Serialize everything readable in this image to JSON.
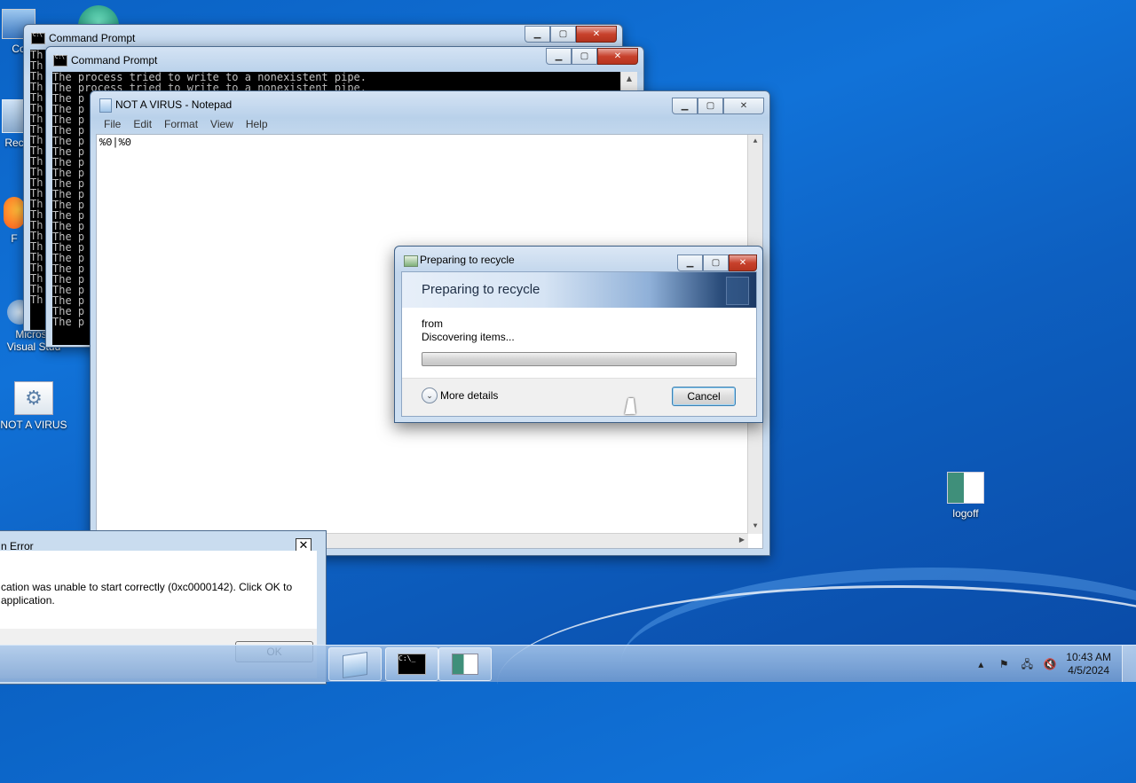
{
  "desktop": {
    "icons": [
      {
        "label": "Co"
      },
      {
        "label": "Rec"
      },
      {
        "label": "F"
      },
      {
        "label": "Microsc Visual Stud"
      },
      {
        "label": "NOT A VIRUS"
      },
      {
        "label": "logoff"
      }
    ]
  },
  "cmd_back": {
    "title": "Command Prompt",
    "lines": [
      "Th",
      "Th",
      "Th",
      "Th",
      "Th",
      "Th",
      "Th",
      "Th",
      "Th",
      "Th",
      "Th",
      "Th",
      "Th",
      "Th",
      "Th",
      "Th",
      "Th",
      "Th",
      "Th",
      "Th",
      "Th",
      "Th",
      "Th",
      "Th"
    ]
  },
  "cmd_front": {
    "title": "Command Prompt",
    "lines": [
      "The process tried to write to a nonexistent pipe.",
      "The process tried to write to a nonexistent pipe.",
      "The p",
      "The p",
      "The p",
      "The p",
      "The p",
      "The p",
      "The p",
      "The p",
      "The p",
      "The p",
      "The p",
      "The p",
      "The p",
      "The p",
      "The p",
      "The p",
      "The p",
      "The p",
      "The p",
      "The p",
      "The p",
      "The p"
    ]
  },
  "notepad": {
    "title": "NOT A VIRUS - Notepad",
    "menu": [
      "File",
      "Edit",
      "Format",
      "View",
      "Help"
    ],
    "content": "%0|%0"
  },
  "recycle_dialog": {
    "title": "Preparing to recycle",
    "heading": "Preparing to recycle",
    "from_label": "from",
    "status": "Discovering items...",
    "progress": 0,
    "more_details": "More details",
    "cancel": "Cancel"
  },
  "error_dialog": {
    "title": "n Error",
    "message_line1": "cation was unable to start correctly (0xc0000142). Click OK to",
    "message_line2": "application.",
    "ok": "OK"
  },
  "taskbar": {
    "time": "10:43 AM",
    "date": "4/5/2024"
  }
}
